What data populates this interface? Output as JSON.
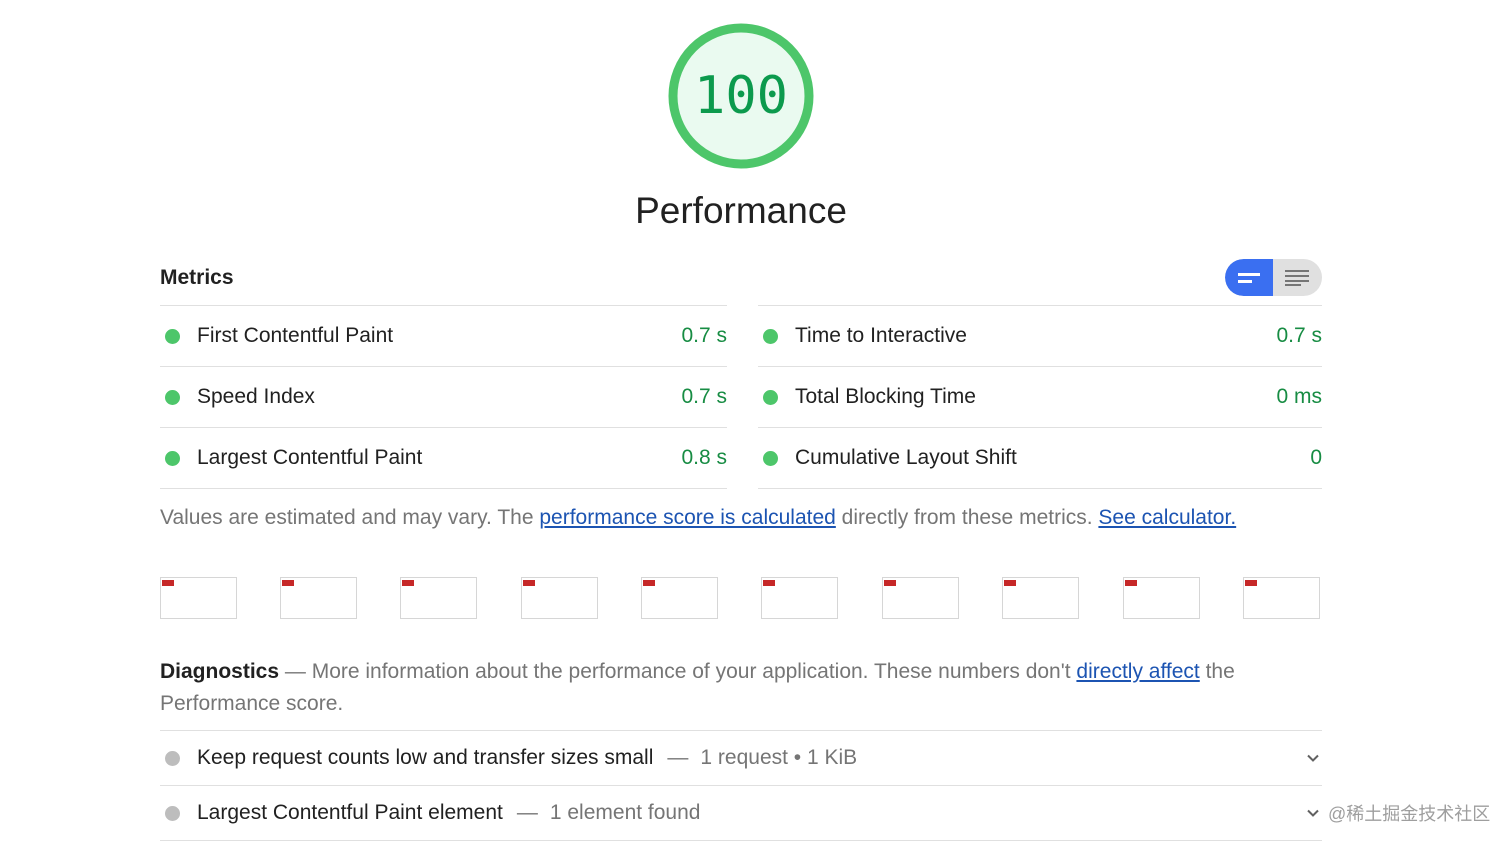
{
  "gauge": {
    "score": "100",
    "category": "Performance",
    "color": "#0c9a4d",
    "ring_color": "#4dc66a",
    "fill_color": "#eafaf0"
  },
  "metrics": {
    "header": "Metrics",
    "view_toggle": {
      "active": "summary",
      "icons": [
        "bars-summary-icon",
        "list-detail-icon"
      ]
    },
    "left": [
      {
        "label": "First Contentful Paint",
        "value": "0.7 s",
        "status": "pass"
      },
      {
        "label": "Speed Index",
        "value": "0.7 s",
        "status": "pass"
      },
      {
        "label": "Largest Contentful Paint",
        "value": "0.8 s",
        "status": "pass"
      }
    ],
    "right": [
      {
        "label": "Time to Interactive",
        "value": "0.7 s",
        "status": "pass"
      },
      {
        "label": "Total Blocking Time",
        "value": "0 ms",
        "status": "pass"
      },
      {
        "label": "Cumulative Layout Shift",
        "value": "0",
        "status": "pass"
      }
    ]
  },
  "note": {
    "prefix": "Values are estimated and may vary. The ",
    "link1": "performance score is calculated",
    "middle": " directly from these metrics. ",
    "link2": "See calculator."
  },
  "filmstrip": {
    "frame_count": 10
  },
  "diagnostics": {
    "title": "Diagnostics",
    "dash": " — ",
    "desc_prefix": "More information about the performance of your application. These numbers don't ",
    "desc_link": "directly affect",
    "desc_suffix": " the Performance score.",
    "audits": [
      {
        "title": "Keep request counts low and transfer sizes small",
        "sep": "—",
        "detail": "1 request • 1 KiB"
      },
      {
        "title": "Largest Contentful Paint element",
        "sep": "—",
        "detail": "1 element found"
      }
    ]
  },
  "watermark": "@稀土掘金技术社区",
  "colors": {
    "pass": "#4dc66a",
    "pass_text": "#178c43",
    "informative": "#bdbdbd",
    "link": "#1c54b2",
    "toggle_active": "#3a6ff1"
  }
}
